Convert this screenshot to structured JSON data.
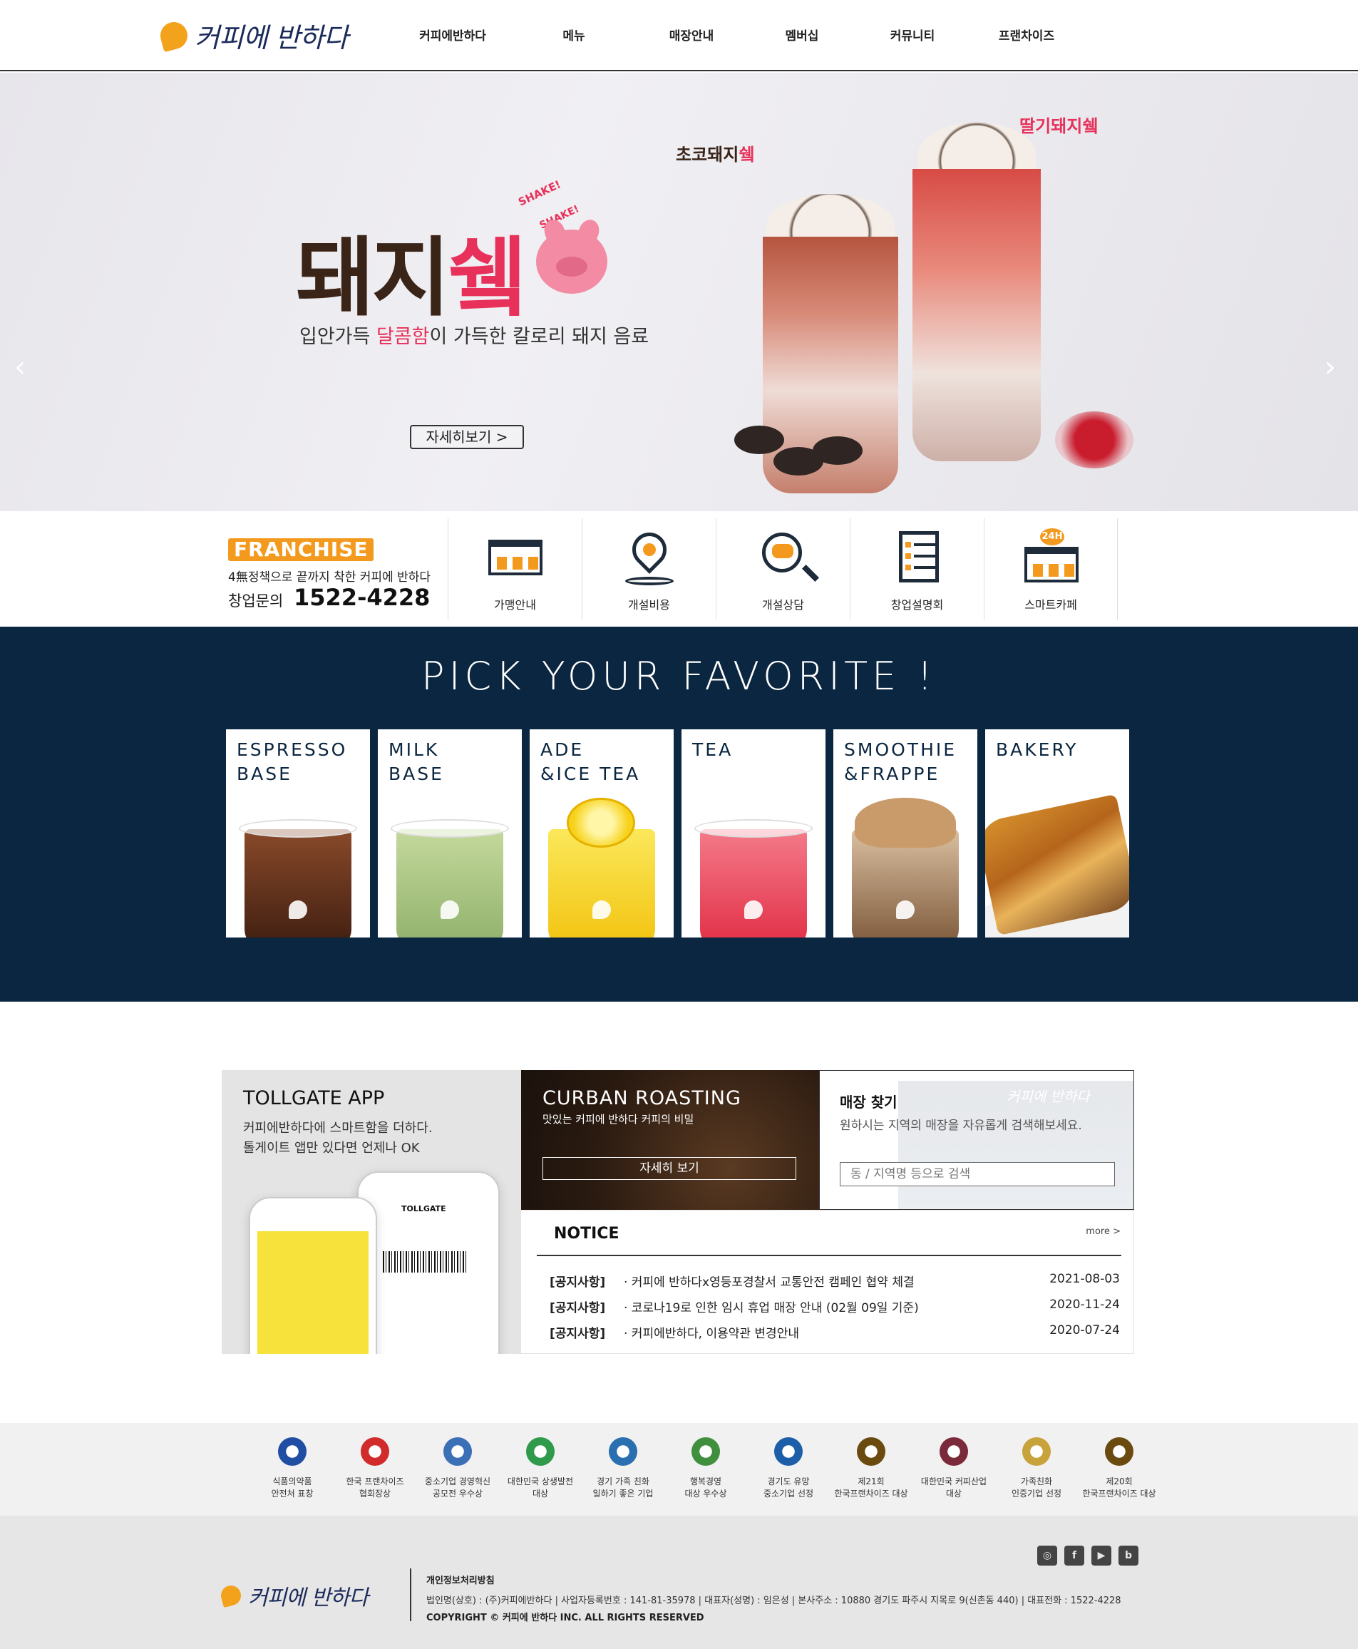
{
  "header": {
    "logo_text": "커피에 반하다",
    "nav": [
      "커피에반하다",
      "메뉴",
      "매장안내",
      "멤버십",
      "커뮤니티",
      "프랜차이즈"
    ]
  },
  "hero": {
    "title_part1": "돼지",
    "title_part2": "쉨",
    "shake_top": "SHAKE!",
    "shake_bottom": "SHAKE!",
    "sub_part1": "입안가득 ",
    "sub_highlight": "달콤함",
    "sub_part2": "이 가득한 칼로리 돼지 음료",
    "label_choco_1": "초코돼지",
    "label_choco_2": "쉨",
    "label_straw": "딸기돼지쉨",
    "button": "자세히보기 >",
    "arrow_prev": "‹",
    "arrow_next": "›",
    "slides": 4,
    "active_slide": 1
  },
  "franchise": {
    "badge": "FRANCHISE",
    "desc": "4無정책으로 끝까지 착한 커피에 반하다",
    "phone_label": "창업문의",
    "phone": "1522-4228",
    "items": [
      {
        "label": "가맹안내",
        "icon": "shop-icon"
      },
      {
        "label": "개설비용",
        "icon": "location-pin-icon"
      },
      {
        "label": "개설상담",
        "icon": "consult-search-icon"
      },
      {
        "label": "창업설명회",
        "icon": "document-icon"
      },
      {
        "label": "스마트카페",
        "icon": "smart-cafe-24h-icon"
      }
    ],
    "badge_24h": "24H"
  },
  "pick": {
    "title": "PICK YOUR FAVORITE !",
    "cards": [
      {
        "title": "ESPRESSO\nBASE",
        "color": "#6b3a22"
      },
      {
        "title": "MILK\nBASE",
        "color": "#9fbf79"
      },
      {
        "title": "ADE\n&ICE TEA",
        "color": "#f6d12a"
      },
      {
        "title": "TEA",
        "color": "#ef3f52"
      },
      {
        "title": "SMOOTHIE\n&FRAPPE",
        "color": "#a57b53"
      },
      {
        "title": "BAKERY",
        "color": "#c27a2c"
      }
    ]
  },
  "app": {
    "title": "TOLLGATE APP",
    "desc_line1": "커피에반하다에 스마트함을 더하다.",
    "desc_line2": "톨게이트 앱만 있다면 언제나 OK",
    "phone_label": "TOLLGATE"
  },
  "roast": {
    "title": "CURBAN ROASTING",
    "sub": "맛있는 커피에 반하다 커피의 비밀",
    "button": "자세히 보기"
  },
  "store": {
    "title": "매장 찾기",
    "desc": "원하시는 지역의 매장을 자유롭게 검색해보세요.",
    "placeholder": "동 / 지역명 등으로 검색",
    "logo": "커피에 반하다"
  },
  "notice": {
    "title": "NOTICE",
    "more": "more >",
    "rows": [
      {
        "tag": "[공지사항]",
        "text": "· 커피에 반하다x영등포경찰서 교통안전 캠페인 협약 체결",
        "date": "2021-08-03"
      },
      {
        "tag": "[공지사항]",
        "text": "· 코로나19로 인한 임시 휴업 매장 안내 (02월 09일 기준)",
        "date": "2020-11-24"
      },
      {
        "tag": "[공지사항]",
        "text": "· 커피에반하다, 이용약관 변경안내",
        "date": "2020-07-24"
      }
    ]
  },
  "awards": [
    {
      "label": "식품의약품\n안전처 표창",
      "color": "#1f4ea3"
    },
    {
      "label": "한국 프랜차이즈\n협회장상",
      "color": "#d12b2b"
    },
    {
      "label": "중소기업 경영혁신\n공모전 우수상",
      "color": "#3b6fb6"
    },
    {
      "label": "대한민국 상생발전\n대상",
      "color": "#2e9a4a"
    },
    {
      "label": "경기 가족 친화\n일하기 좋은 기업",
      "color": "#2a6fb0"
    },
    {
      "label": "행복경영\n대상 우수상",
      "color": "#3f8f3f"
    },
    {
      "label": "경기도 유망\n중소기업 선정",
      "color": "#1c5fa8"
    },
    {
      "label": "제21회\n한국프랜차이즈 대상",
      "color": "#6b4a10"
    },
    {
      "label": "대한민국 커피산업\n대상",
      "color": "#7a2a3a"
    },
    {
      "label": "가족친화\n인증기업 선정",
      "color": "#c8a23a"
    },
    {
      "label": "제20회\n한국프랜차이즈 대상",
      "color": "#6b4a10"
    }
  ],
  "footer": {
    "logo": "커피에 반하다",
    "policy": "개인정보처리방침",
    "info": "법인명(상호) : (주)커피에반하다 | 사업자등록번호 : 141-81-35978 | 대표자(성명) : 임은성 | 본사주소 : 10880 경기도 파주시 지목로 9(신촌동 440) | 대표전화 : 1522-4228",
    "copyright": "COPYRIGHT © 커피에 반하다 INC. ALL RIGHTS RESERVED",
    "social": [
      {
        "name": "instagram-icon",
        "glyph": "◎"
      },
      {
        "name": "facebook-icon",
        "glyph": "f"
      },
      {
        "name": "youtube-icon",
        "glyph": "▶"
      },
      {
        "name": "blog-icon",
        "glyph": "b"
      }
    ]
  }
}
